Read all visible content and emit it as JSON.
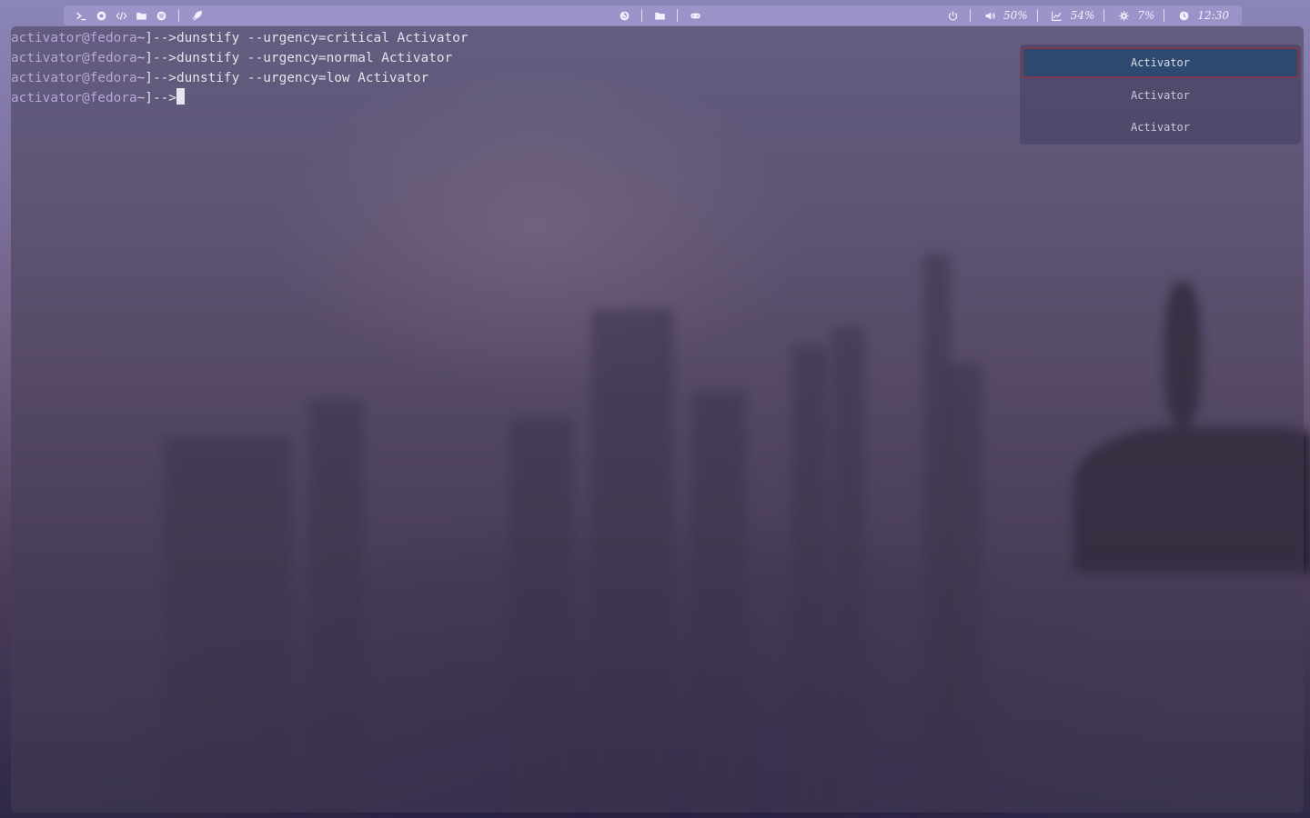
{
  "topbar": {
    "left_icons": [
      "terminal-icon",
      "firefox-icon",
      "code-icon",
      "folder-icon",
      "spotify-icon",
      "rocket-icon"
    ],
    "center_icons": [
      "refresh-icon",
      "folder-icon",
      "gamepad-icon"
    ],
    "power_icon": "power-icon",
    "volume": {
      "icon": "volume-icon",
      "value": "50%"
    },
    "memory": {
      "icon": "chart-icon",
      "value": "54%"
    },
    "cpu": {
      "icon": "cpu-icon",
      "value": "7%"
    },
    "clock": {
      "icon": "clock-icon",
      "value": "12:30"
    }
  },
  "terminal": {
    "prompt_user": "activator@fedora",
    "prompt_path": "~",
    "prompt_suffix": "]-->",
    "commands": [
      "dunstify --urgency=critical Activator",
      "dunstify --urgency=normal Activator",
      "dunstify --urgency=low Activator"
    ]
  },
  "notifications": [
    {
      "urgency": "critical",
      "text": "Activator"
    },
    {
      "urgency": "normal",
      "text": "Activator"
    },
    {
      "urgency": "low",
      "text": "Activator"
    }
  ],
  "colors": {
    "critical_bg": "#2f4a70",
    "critical_border": "#7a3a4c",
    "prompt_user": "#b7a6d8"
  }
}
